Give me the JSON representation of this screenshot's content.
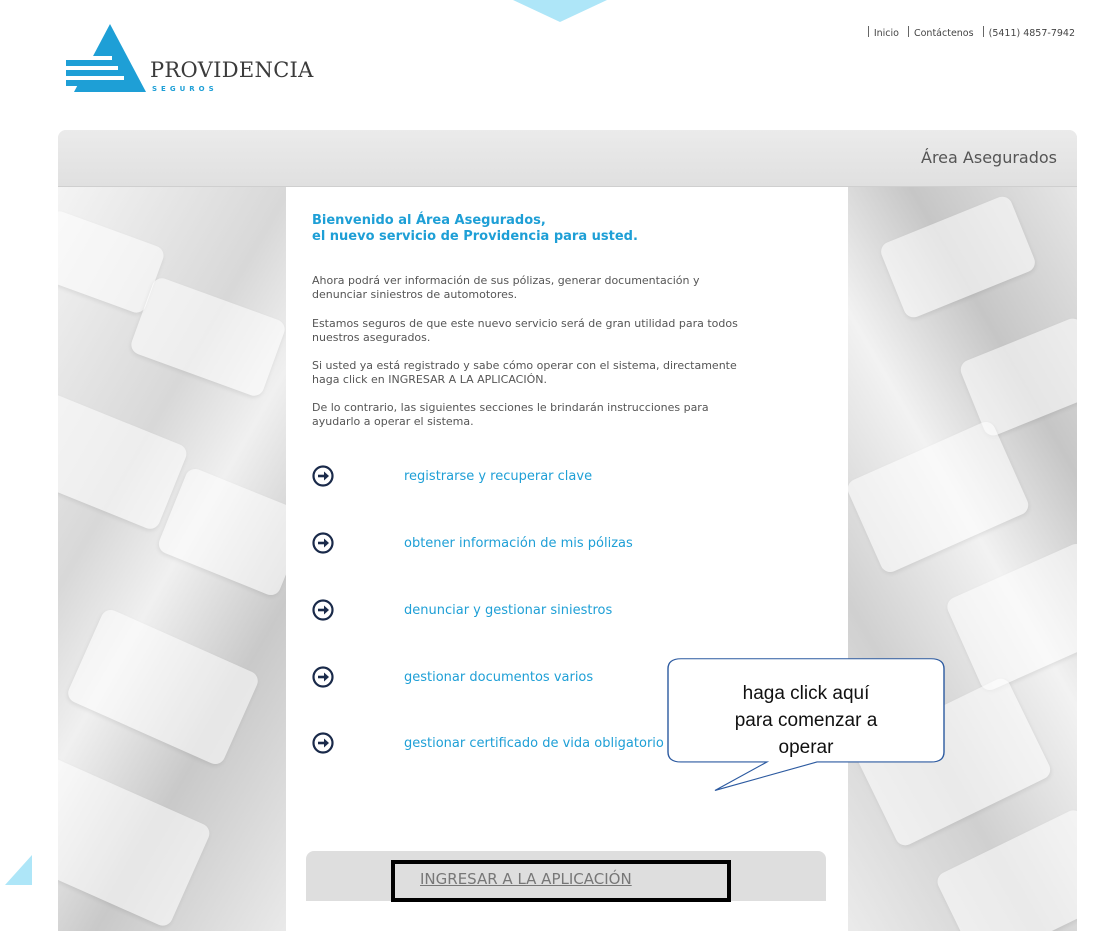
{
  "brand": {
    "name": "PROVIDENCIA",
    "sub": "SEGUROS"
  },
  "toplinks": {
    "inicio": "Inicio",
    "contactenos": "Contáctenos",
    "phone": "(5411) 4857-7942"
  },
  "header": {
    "title": "Área Asegurados"
  },
  "intro": {
    "line1": "Bienvenido al Área Asegurados,",
    "line2": "el nuevo servicio de Providencia para usted.",
    "p1a": "Ahora podrá ver información de sus pólizas, generar documentación y",
    "p1b": "denunciar siniestros de automotores.",
    "p2a": "Estamos seguros de que este nuevo servicio será de gran utilidad para todos",
    "p2b": "nuestros asegurados.",
    "p3a": "Si usted ya está registrado y sabe cómo operar con el sistema, directamente",
    "p3b": "haga click en INGRESAR A LA APLICACIÓN.",
    "p4a": "De lo contrario, las siguientes secciones le brindarán instrucciones para",
    "p4b": "ayudarlo a operar el sistema."
  },
  "nav": {
    "registrarse": "registrarse y recuperar clave",
    "polizas": "obtener información de mis pólizas",
    "siniestros": "denunciar y gestionar siniestros",
    "documentos": "gestionar documentos varios",
    "certificado": "gestionar certificado de vida obligatorio"
  },
  "enter": {
    "label": "INGRESAR A LA APLICACIÓN"
  },
  "callout": {
    "line1": "haga click aquí",
    "line2": "para comenzar a",
    "line3": "operar"
  },
  "colors": {
    "accent": "#1e9fd6",
    "deco": "#aee6f8"
  }
}
